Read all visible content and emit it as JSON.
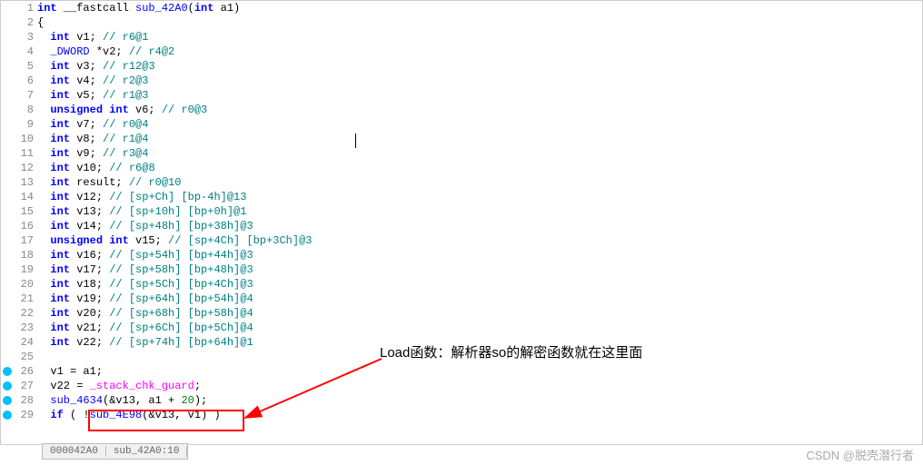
{
  "lines": [
    {
      "n": 1,
      "bp": false,
      "tokens": [
        {
          "t": "kw",
          "v": "int"
        },
        {
          "t": "plain",
          "v": " __fastcall "
        },
        {
          "t": "fn",
          "v": "sub_42A0"
        },
        {
          "t": "plain",
          "v": "("
        },
        {
          "t": "kw",
          "v": "int"
        },
        {
          "t": "plain",
          "v": " a1)"
        }
      ]
    },
    {
      "n": 2,
      "bp": false,
      "tokens": [
        {
          "t": "plain",
          "v": "{"
        }
      ]
    },
    {
      "n": 3,
      "bp": false,
      "tokens": [
        {
          "t": "plain",
          "v": "  "
        },
        {
          "t": "kw",
          "v": "int"
        },
        {
          "t": "plain",
          "v": " v1; "
        },
        {
          "t": "cmt",
          "v": "// r6@1"
        }
      ]
    },
    {
      "n": 4,
      "bp": false,
      "tokens": [
        {
          "t": "plain",
          "v": "  "
        },
        {
          "t": "typ",
          "v": "_DWORD"
        },
        {
          "t": "plain",
          "v": " *v2; "
        },
        {
          "t": "cmt",
          "v": "// r4@2"
        }
      ]
    },
    {
      "n": 5,
      "bp": false,
      "tokens": [
        {
          "t": "plain",
          "v": "  "
        },
        {
          "t": "kw",
          "v": "int"
        },
        {
          "t": "plain",
          "v": " v3; "
        },
        {
          "t": "cmt",
          "v": "// r12@3"
        }
      ]
    },
    {
      "n": 6,
      "bp": false,
      "tokens": [
        {
          "t": "plain",
          "v": "  "
        },
        {
          "t": "kw",
          "v": "int"
        },
        {
          "t": "plain",
          "v": " v4; "
        },
        {
          "t": "cmt",
          "v": "// r2@3"
        }
      ]
    },
    {
      "n": 7,
      "bp": false,
      "tokens": [
        {
          "t": "plain",
          "v": "  "
        },
        {
          "t": "kw",
          "v": "int"
        },
        {
          "t": "plain",
          "v": " v5; "
        },
        {
          "t": "cmt",
          "v": "// r1@3"
        }
      ]
    },
    {
      "n": 8,
      "bp": false,
      "tokens": [
        {
          "t": "plain",
          "v": "  "
        },
        {
          "t": "kw",
          "v": "unsigned"
        },
        {
          "t": "plain",
          "v": " "
        },
        {
          "t": "kw",
          "v": "int"
        },
        {
          "t": "plain",
          "v": " v6; "
        },
        {
          "t": "cmt",
          "v": "// r0@3"
        }
      ]
    },
    {
      "n": 9,
      "bp": false,
      "tokens": [
        {
          "t": "plain",
          "v": "  "
        },
        {
          "t": "kw",
          "v": "int"
        },
        {
          "t": "plain",
          "v": " v7; "
        },
        {
          "t": "cmt",
          "v": "// r0@4"
        }
      ]
    },
    {
      "n": 10,
      "bp": false,
      "tokens": [
        {
          "t": "plain",
          "v": "  "
        },
        {
          "t": "kw",
          "v": "int"
        },
        {
          "t": "plain",
          "v": " v8; "
        },
        {
          "t": "cmt",
          "v": "// r1@4"
        }
      ]
    },
    {
      "n": 11,
      "bp": false,
      "tokens": [
        {
          "t": "plain",
          "v": "  "
        },
        {
          "t": "kw",
          "v": "int"
        },
        {
          "t": "plain",
          "v": " v9; "
        },
        {
          "t": "cmt",
          "v": "// r3@4"
        }
      ]
    },
    {
      "n": 12,
      "bp": false,
      "tokens": [
        {
          "t": "plain",
          "v": "  "
        },
        {
          "t": "kw",
          "v": "int"
        },
        {
          "t": "plain",
          "v": " v10; "
        },
        {
          "t": "cmt",
          "v": "// r6@8"
        }
      ]
    },
    {
      "n": 13,
      "bp": false,
      "tokens": [
        {
          "t": "plain",
          "v": "  "
        },
        {
          "t": "kw",
          "v": "int"
        },
        {
          "t": "plain",
          "v": " result; "
        },
        {
          "t": "cmt",
          "v": "// r0@10"
        }
      ]
    },
    {
      "n": 14,
      "bp": false,
      "tokens": [
        {
          "t": "plain",
          "v": "  "
        },
        {
          "t": "kw",
          "v": "int"
        },
        {
          "t": "plain",
          "v": " v12; "
        },
        {
          "t": "cmt",
          "v": "// [sp+Ch] [bp-4h]@13"
        }
      ]
    },
    {
      "n": 15,
      "bp": false,
      "tokens": [
        {
          "t": "plain",
          "v": "  "
        },
        {
          "t": "kw",
          "v": "int"
        },
        {
          "t": "plain",
          "v": " v13; "
        },
        {
          "t": "cmt",
          "v": "// [sp+10h] [bp+0h]@1"
        }
      ]
    },
    {
      "n": 16,
      "bp": false,
      "tokens": [
        {
          "t": "plain",
          "v": "  "
        },
        {
          "t": "kw",
          "v": "int"
        },
        {
          "t": "plain",
          "v": " v14; "
        },
        {
          "t": "cmt",
          "v": "// [sp+48h] [bp+38h]@3"
        }
      ]
    },
    {
      "n": 17,
      "bp": false,
      "tokens": [
        {
          "t": "plain",
          "v": "  "
        },
        {
          "t": "kw",
          "v": "unsigned"
        },
        {
          "t": "plain",
          "v": " "
        },
        {
          "t": "kw",
          "v": "int"
        },
        {
          "t": "plain",
          "v": " v15; "
        },
        {
          "t": "cmt",
          "v": "// [sp+4Ch] [bp+3Ch]@3"
        }
      ]
    },
    {
      "n": 18,
      "bp": false,
      "tokens": [
        {
          "t": "plain",
          "v": "  "
        },
        {
          "t": "kw",
          "v": "int"
        },
        {
          "t": "plain",
          "v": " v16; "
        },
        {
          "t": "cmt",
          "v": "// [sp+54h] [bp+44h]@3"
        }
      ]
    },
    {
      "n": 19,
      "bp": false,
      "tokens": [
        {
          "t": "plain",
          "v": "  "
        },
        {
          "t": "kw",
          "v": "int"
        },
        {
          "t": "plain",
          "v": " v17; "
        },
        {
          "t": "cmt",
          "v": "// [sp+58h] [bp+48h]@3"
        }
      ]
    },
    {
      "n": 20,
      "bp": false,
      "tokens": [
        {
          "t": "plain",
          "v": "  "
        },
        {
          "t": "kw",
          "v": "int"
        },
        {
          "t": "plain",
          "v": " v18; "
        },
        {
          "t": "cmt",
          "v": "// [sp+5Ch] [bp+4Ch]@3"
        }
      ]
    },
    {
      "n": 21,
      "bp": false,
      "tokens": [
        {
          "t": "plain",
          "v": "  "
        },
        {
          "t": "kw",
          "v": "int"
        },
        {
          "t": "plain",
          "v": " v19; "
        },
        {
          "t": "cmt",
          "v": "// [sp+64h] [bp+54h]@4"
        }
      ]
    },
    {
      "n": 22,
      "bp": false,
      "tokens": [
        {
          "t": "plain",
          "v": "  "
        },
        {
          "t": "kw",
          "v": "int"
        },
        {
          "t": "plain",
          "v": " v20; "
        },
        {
          "t": "cmt",
          "v": "// [sp+68h] [bp+58h]@4"
        }
      ]
    },
    {
      "n": 23,
      "bp": false,
      "tokens": [
        {
          "t": "plain",
          "v": "  "
        },
        {
          "t": "kw",
          "v": "int"
        },
        {
          "t": "plain",
          "v": " v21; "
        },
        {
          "t": "cmt",
          "v": "// [sp+6Ch] [bp+5Ch]@4"
        }
      ]
    },
    {
      "n": 24,
      "bp": false,
      "tokens": [
        {
          "t": "plain",
          "v": "  "
        },
        {
          "t": "kw",
          "v": "int"
        },
        {
          "t": "plain",
          "v": " v22; "
        },
        {
          "t": "cmt",
          "v": "// [sp+74h] [bp+64h]@1"
        }
      ]
    },
    {
      "n": 25,
      "bp": false,
      "tokens": []
    },
    {
      "n": 26,
      "bp": true,
      "tokens": [
        {
          "t": "plain",
          "v": "  v1 = a1;"
        }
      ]
    },
    {
      "n": 27,
      "bp": true,
      "tokens": [
        {
          "t": "plain",
          "v": "  v22 = "
        },
        {
          "t": "fnhl",
          "v": "_stack_chk_guard"
        },
        {
          "t": "plain",
          "v": ";"
        }
      ]
    },
    {
      "n": 28,
      "bp": true,
      "tokens": [
        {
          "t": "plain",
          "v": "  "
        },
        {
          "t": "fn",
          "v": "sub_4634"
        },
        {
          "t": "plain",
          "v": "(&v13, a1 + "
        },
        {
          "t": "num",
          "v": "20"
        },
        {
          "t": "plain",
          "v": ");"
        }
      ]
    },
    {
      "n": 29,
      "bp": true,
      "tokens": [
        {
          "t": "plain",
          "v": "  "
        },
        {
          "t": "kw",
          "v": "if"
        },
        {
          "t": "plain",
          "v": " ( !"
        },
        {
          "t": "fn",
          "v": "sub_4E98"
        },
        {
          "t": "plain",
          "v": "(&v13, v1) )"
        }
      ]
    }
  ],
  "status": {
    "addr": "000042A0",
    "loc": "sub_42A0:10"
  },
  "annotation": "Load函数：解析器so的解密函数就在这里面",
  "watermark": "CSDN @脱壳潜行者"
}
